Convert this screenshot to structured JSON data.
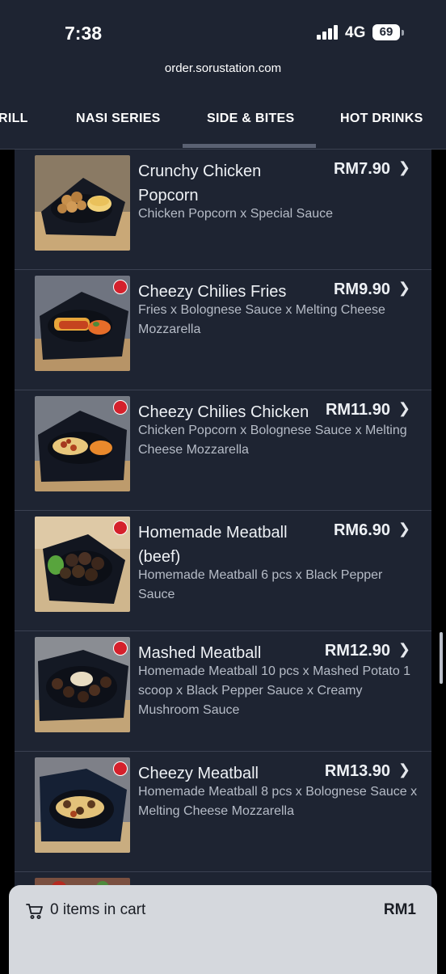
{
  "status": {
    "time": "7:38",
    "network": "4G",
    "battery": "69"
  },
  "browser": {
    "url": "order.sorustation.com"
  },
  "tabs": [
    {
      "label": "RILL"
    },
    {
      "label": "NASI SERIES"
    },
    {
      "label": "SIDE & BITES",
      "active": true
    },
    {
      "label": "HOT DRINKS"
    }
  ],
  "items": [
    {
      "name": "Crunchy Chicken Popcorn",
      "price": "RM7.90",
      "description": "Chicken Popcorn x Special Sauce",
      "badge": false
    },
    {
      "name": "Cheezy Chilies Fries",
      "price": "RM9.90",
      "description": "Fries x Bolognese Sauce x Melting Cheese Mozzarella",
      "badge": true
    },
    {
      "name": "Cheezy Chilies Chicken",
      "price": "RM11.90",
      "description": "Chicken Popcorn x Bolognese Sauce x Melting Cheese Mozzarella",
      "badge": true
    },
    {
      "name": "Homemade Meatball (beef)",
      "price": "RM6.90",
      "description": "Homemade Meatball 6 pcs x Black Pepper Sauce",
      "badge": true
    },
    {
      "name": "Mashed Meatball",
      "price": "RM12.90",
      "description": "Homemade Meatball 10 pcs x Mashed Potato 1 scoop x Black Pepper Sauce x Creamy Mushroom Sauce",
      "badge": true
    },
    {
      "name": "Cheezy Meatball",
      "price": "RM13.90",
      "description": "Homemade Meatball 8 pcs x Bolognese Sauce x Melting Cheese Mozzarella",
      "badge": true
    }
  ],
  "cart": {
    "label": "0 items in cart",
    "total": "RM1"
  },
  "icons": {
    "chevron": "chevron-right-icon",
    "cart": "shopping-cart-icon"
  },
  "colors": {
    "header_bg": "#1e2432",
    "list_bg": "#1e2432",
    "cart_bg": "#d5d8dd",
    "badge": "#d4212c"
  }
}
